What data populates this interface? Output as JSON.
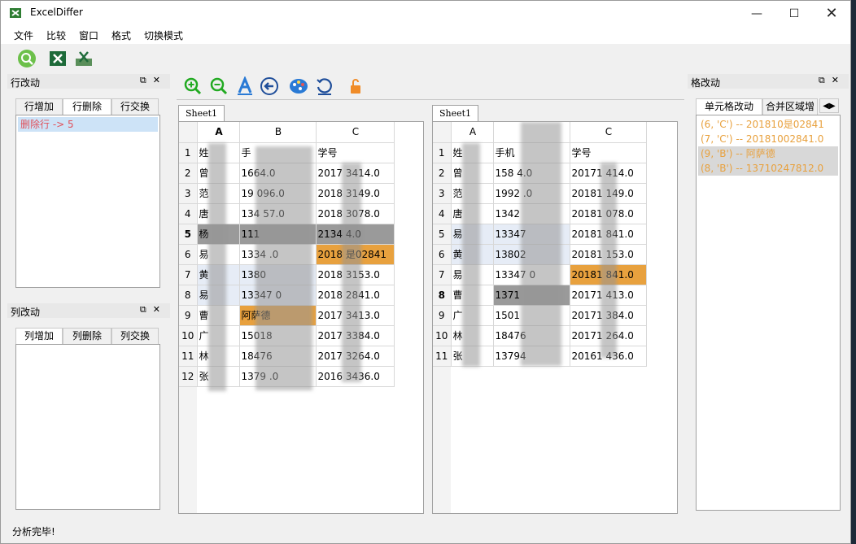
{
  "window": {
    "title": "ExcelDiffer"
  },
  "menu": [
    "文件",
    "比较",
    "窗口",
    "格式",
    "切换模式"
  ],
  "toolbar_icons": [
    "search-icon",
    "excel-icon",
    "excel-compare-icon"
  ],
  "content_toolbar_icons": [
    "zoom-in-icon",
    "zoom-out-icon",
    "font-icon",
    "back-icon",
    "palette-icon",
    "refresh-icon",
    "unlock-icon"
  ],
  "row_changes": {
    "title": "行改动",
    "tabs": [
      "行增加",
      "行删除",
      "行交换"
    ],
    "active_tab": 1,
    "items": [
      "删除行 -> 5"
    ]
  },
  "col_changes": {
    "title": "列改动",
    "tabs": [
      "列增加",
      "列删除",
      "列交换"
    ],
    "active_tab": 0,
    "items": []
  },
  "cell_changes": {
    "title": "格改动",
    "tabs": [
      "单元格改动",
      "合并区域增"
    ],
    "active_tab": 0,
    "items": [
      "(6, 'C') -- 201810是02841",
      "(7, 'C') -- 20181002841.0",
      "(9, 'B') -- 阿萨德",
      "(8, 'B') -- 13710247812.0"
    ]
  },
  "left_sheet": {
    "tab": "Sheet1",
    "columns": [
      "A",
      "B",
      "C"
    ],
    "rows": [
      [
        "1",
        "姓",
        "手",
        "学号"
      ],
      [
        "2",
        "曾",
        "1664.0",
        "2017 3414.0"
      ],
      [
        "3",
        "范",
        "19 096.0",
        "2018 3149.0"
      ],
      [
        "4",
        "唐",
        "134 57.0",
        "2018 3078.0"
      ],
      [
        "5",
        "杨",
        "111",
        "2134 4.0"
      ],
      [
        "6",
        "易",
        "1334 .0",
        "2018 是02841"
      ],
      [
        "7",
        "黄",
        "1380",
        "2018 3153.0"
      ],
      [
        "8",
        "易",
        "13347 0",
        "2018 2841.0"
      ],
      [
        "9",
        "曹",
        "阿萨德",
        "2017 3413.0"
      ],
      [
        "10",
        "广",
        "15018",
        "2017 3384.0"
      ],
      [
        "11",
        "林",
        "18476",
        "2017 3264.0"
      ],
      [
        "12",
        "张",
        "1379 .0",
        "2016 3436.0"
      ]
    ]
  },
  "right_sheet": {
    "tab": "Sheet1",
    "columns": [
      "A",
      "",
      "C"
    ],
    "rows": [
      [
        "1",
        "姓",
        "手机",
        "学号"
      ],
      [
        "2",
        "曾",
        "158 4.0",
        "20171 414.0"
      ],
      [
        "3",
        "范",
        "1992 .0",
        "20181 149.0"
      ],
      [
        "4",
        "唐",
        "1342",
        "20181 078.0"
      ],
      [
        "5",
        "易",
        "13347",
        "20181 841.0"
      ],
      [
        "6",
        "黄",
        "13802",
        "20181 153.0"
      ],
      [
        "7",
        "易",
        "13347 0",
        "20181 841.0"
      ],
      [
        "8",
        "曹",
        "1371",
        "20171 413.0"
      ],
      [
        "9",
        "广",
        "1501",
        "20171 384.0"
      ],
      [
        "10",
        "林",
        "18476",
        "20171 264.0"
      ],
      [
        "11",
        "张",
        "13794",
        "20161 436.0"
      ]
    ]
  },
  "status": "分析完毕!",
  "colors": {
    "changed": "#e8a13e",
    "deleted": "#9a9a9a",
    "removed_text": "#e0505a",
    "changed_text": "#e8a13e"
  }
}
